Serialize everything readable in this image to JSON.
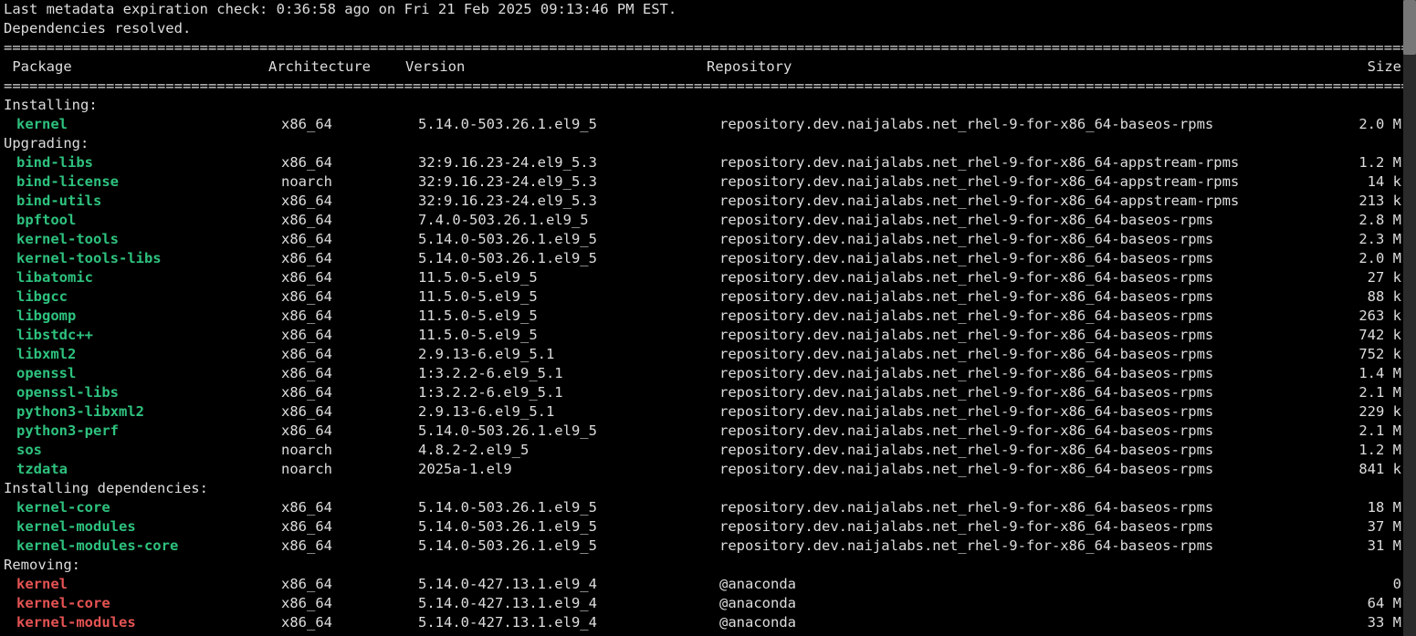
{
  "preamble": {
    "line1": "Last metadata expiration check: 0:36:58 ago on Fri 21 Feb 2025 09:13:46 PM EST.",
    "line2": "Dependencies resolved."
  },
  "rule": "=======================================================================================================================================================================",
  "headers": {
    "package": " Package",
    "arch": "Architecture",
    "version": "Version",
    "repo": "Repository",
    "size": "Size"
  },
  "sections": {
    "installing": "Installing:",
    "upgrading": "Upgrading:",
    "installing_deps": "Installing dependencies:",
    "removing": "Removing:"
  },
  "installing": [
    {
      "pkg": "kernel",
      "arch": "x86_64",
      "ver": "5.14.0-503.26.1.el9_5",
      "repo": "repository.dev.naijalabs.net_rhel-9-for-x86_64-baseos-rpms",
      "size": "2.0 M"
    }
  ],
  "upgrading": [
    {
      "pkg": "bind-libs",
      "arch": "x86_64",
      "ver": "32:9.16.23-24.el9_5.3",
      "repo": "repository.dev.naijalabs.net_rhel-9-for-x86_64-appstream-rpms",
      "size": "1.2 M"
    },
    {
      "pkg": "bind-license",
      "arch": "noarch",
      "ver": "32:9.16.23-24.el9_5.3",
      "repo": "repository.dev.naijalabs.net_rhel-9-for-x86_64-appstream-rpms",
      "size": "14 k"
    },
    {
      "pkg": "bind-utils",
      "arch": "x86_64",
      "ver": "32:9.16.23-24.el9_5.3",
      "repo": "repository.dev.naijalabs.net_rhel-9-for-x86_64-appstream-rpms",
      "size": "213 k"
    },
    {
      "pkg": "bpftool",
      "arch": "x86_64",
      "ver": "7.4.0-503.26.1.el9_5",
      "repo": "repository.dev.naijalabs.net_rhel-9-for-x86_64-baseos-rpms",
      "size": "2.8 M"
    },
    {
      "pkg": "kernel-tools",
      "arch": "x86_64",
      "ver": "5.14.0-503.26.1.el9_5",
      "repo": "repository.dev.naijalabs.net_rhel-9-for-x86_64-baseos-rpms",
      "size": "2.3 M"
    },
    {
      "pkg": "kernel-tools-libs",
      "arch": "x86_64",
      "ver": "5.14.0-503.26.1.el9_5",
      "repo": "repository.dev.naijalabs.net_rhel-9-for-x86_64-baseos-rpms",
      "size": "2.0 M"
    },
    {
      "pkg": "libatomic",
      "arch": "x86_64",
      "ver": "11.5.0-5.el9_5",
      "repo": "repository.dev.naijalabs.net_rhel-9-for-x86_64-baseos-rpms",
      "size": "27 k"
    },
    {
      "pkg": "libgcc",
      "arch": "x86_64",
      "ver": "11.5.0-5.el9_5",
      "repo": "repository.dev.naijalabs.net_rhel-9-for-x86_64-baseos-rpms",
      "size": "88 k"
    },
    {
      "pkg": "libgomp",
      "arch": "x86_64",
      "ver": "11.5.0-5.el9_5",
      "repo": "repository.dev.naijalabs.net_rhel-9-for-x86_64-baseos-rpms",
      "size": "263 k"
    },
    {
      "pkg": "libstdc++",
      "arch": "x86_64",
      "ver": "11.5.0-5.el9_5",
      "repo": "repository.dev.naijalabs.net_rhel-9-for-x86_64-baseos-rpms",
      "size": "742 k"
    },
    {
      "pkg": "libxml2",
      "arch": "x86_64",
      "ver": "2.9.13-6.el9_5.1",
      "repo": "repository.dev.naijalabs.net_rhel-9-for-x86_64-baseos-rpms",
      "size": "752 k"
    },
    {
      "pkg": "openssl",
      "arch": "x86_64",
      "ver": "1:3.2.2-6.el9_5.1",
      "repo": "repository.dev.naijalabs.net_rhel-9-for-x86_64-baseos-rpms",
      "size": "1.4 M"
    },
    {
      "pkg": "openssl-libs",
      "arch": "x86_64",
      "ver": "1:3.2.2-6.el9_5.1",
      "repo": "repository.dev.naijalabs.net_rhel-9-for-x86_64-baseos-rpms",
      "size": "2.1 M"
    },
    {
      "pkg": "python3-libxml2",
      "arch": "x86_64",
      "ver": "2.9.13-6.el9_5.1",
      "repo": "repository.dev.naijalabs.net_rhel-9-for-x86_64-baseos-rpms",
      "size": "229 k"
    },
    {
      "pkg": "python3-perf",
      "arch": "x86_64",
      "ver": "5.14.0-503.26.1.el9_5",
      "repo": "repository.dev.naijalabs.net_rhel-9-for-x86_64-baseos-rpms",
      "size": "2.1 M"
    },
    {
      "pkg": "sos",
      "arch": "noarch",
      "ver": "4.8.2-2.el9_5",
      "repo": "repository.dev.naijalabs.net_rhel-9-for-x86_64-baseos-rpms",
      "size": "1.2 M"
    },
    {
      "pkg": "tzdata",
      "arch": "noarch",
      "ver": "2025a-1.el9",
      "repo": "repository.dev.naijalabs.net_rhel-9-for-x86_64-baseos-rpms",
      "size": "841 k"
    }
  ],
  "installing_deps": [
    {
      "pkg": "kernel-core",
      "arch": "x86_64",
      "ver": "5.14.0-503.26.1.el9_5",
      "repo": "repository.dev.naijalabs.net_rhel-9-for-x86_64-baseos-rpms",
      "size": "18 M"
    },
    {
      "pkg": "kernel-modules",
      "arch": "x86_64",
      "ver": "5.14.0-503.26.1.el9_5",
      "repo": "repository.dev.naijalabs.net_rhel-9-for-x86_64-baseos-rpms",
      "size": "37 M"
    },
    {
      "pkg": "kernel-modules-core",
      "arch": "x86_64",
      "ver": "5.14.0-503.26.1.el9_5",
      "repo": "repository.dev.naijalabs.net_rhel-9-for-x86_64-baseos-rpms",
      "size": "31 M"
    }
  ],
  "removing": [
    {
      "pkg": "kernel",
      "arch": "x86_64",
      "ver": "5.14.0-427.13.1.el9_4",
      "repo": "@anaconda",
      "size": "0"
    },
    {
      "pkg": "kernel-core",
      "arch": "x86_64",
      "ver": "5.14.0-427.13.1.el9_4",
      "repo": "@anaconda",
      "size": "64 M"
    },
    {
      "pkg": "kernel-modules",
      "arch": "x86_64",
      "ver": "5.14.0-427.13.1.el9_4",
      "repo": "@anaconda",
      "size": "33 M"
    }
  ]
}
